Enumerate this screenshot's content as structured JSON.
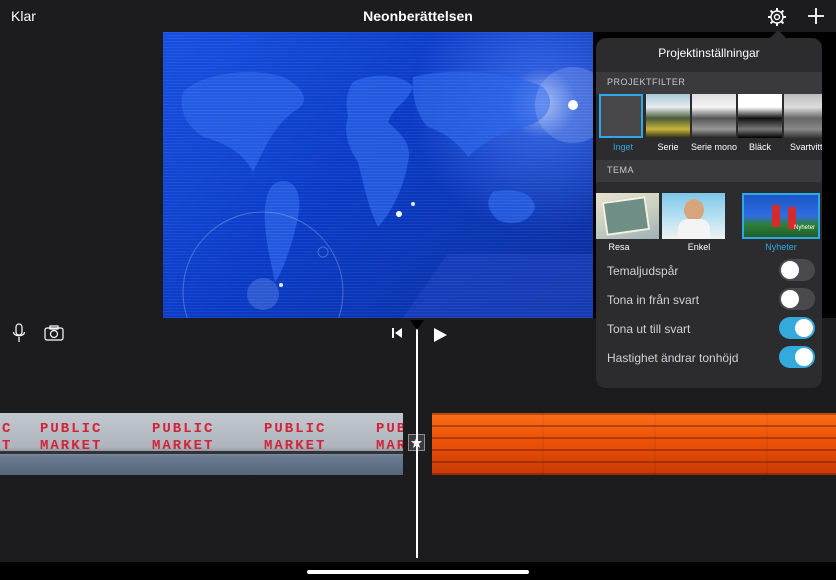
{
  "header": {
    "done_label": "Klar",
    "title": "Neonberättelsen",
    "settings_icon": "gear-icon",
    "add_icon": "plus-icon"
  },
  "toolbar": {
    "mic_icon": "microphone-icon",
    "camera_icon": "camera-icon",
    "skip_back_icon": "skip-to-start-icon",
    "play_icon": "play-icon"
  },
  "timeline": {
    "clip1_sign": "PUBLIC\nMARKET",
    "transition_icon": "star-icon"
  },
  "settings": {
    "title": "Projektinställningar",
    "filter_section": "PROJEKTFILTER",
    "filters": [
      {
        "label": "Inget",
        "selected": true
      },
      {
        "label": "Serie",
        "selected": false
      },
      {
        "label": "Serie mono",
        "selected": false
      },
      {
        "label": "Bläck",
        "selected": false
      },
      {
        "label": "Svartvitt",
        "selected": false
      }
    ],
    "theme_section": "TEMA",
    "themes": [
      {
        "label": "Resa",
        "selected": false
      },
      {
        "label": "Enkel",
        "selected": false
      },
      {
        "label": "Nyheter",
        "selected": true
      }
    ],
    "news_thumb_text": "Nyheter",
    "toggles": [
      {
        "label": "Temaljudspår",
        "on": false
      },
      {
        "label": "Tona in från svart",
        "on": false
      },
      {
        "label": "Tona ut till svart",
        "on": true
      },
      {
        "label": "Hastighet ändrar tonhöjd",
        "on": true
      }
    ]
  },
  "colors": {
    "accent": "#34aadc",
    "selected_label": "#2ea8e6",
    "panel": "#2c2c2e",
    "background": "#1c1c1e"
  }
}
